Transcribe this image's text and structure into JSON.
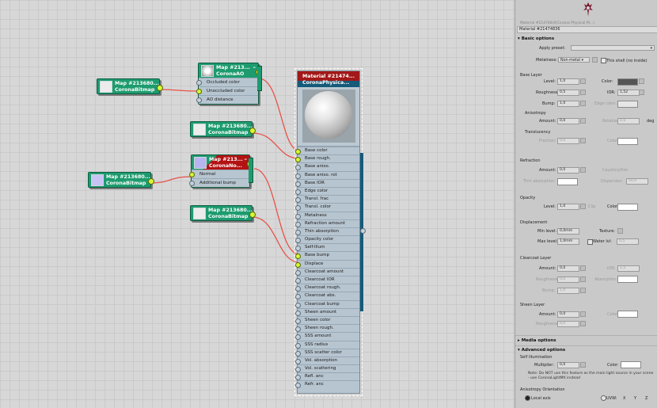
{
  "nodes": {
    "bitmap_a": {
      "title": "Map #213680...",
      "type": "CoronaBitmap"
    },
    "ao": {
      "title": "Map #213...",
      "type": "CoronaAO",
      "slots": [
        "Occluded color",
        "Unoccluded color",
        "AO distance"
      ]
    },
    "bitmap_b": {
      "title": "Map #213680...",
      "type": "CoronaBitmap"
    },
    "normal": {
      "title": "Map #213...",
      "type": "CoronaNo...",
      "slots": [
        "Normal",
        "Additional bump"
      ]
    },
    "bitmap_c": {
      "title": "Map #213680...",
      "type": "CoronaBitmap"
    },
    "bitmap_d": {
      "title": "Map #213680...",
      "type": "CoronaBitmap"
    }
  },
  "material": {
    "title": "Material #21474...",
    "type": "CoronaPhysica...",
    "slots": [
      "Base color",
      "Base rough.",
      "Base aniso.",
      "Base aniso. rot",
      "Base IOR",
      "Edge color",
      "Transl. frac",
      "Transl. color",
      "Metalness",
      "Refraction amount",
      "Thin absorption",
      "Opacity color",
      "Self-Illum",
      "Base bump",
      "Displace",
      "Clearcoat amount",
      "Clearcoat IOR",
      "Clearcoat rough.",
      "Clearcoat abs.",
      "Clearcoat bump",
      "Sheen amount",
      "Sheen color",
      "Sheen rough.",
      "SSS amount",
      "SSS radius",
      "SSS scatter color",
      "Vol. absorption",
      "Vol. scattering",
      "Refl. anc",
      "Refr. anc"
    ],
    "connected": [
      0,
      1,
      13,
      14
    ]
  },
  "panel": {
    "breadcrumb": "Material #214748/4(Corona Physical M...)",
    "material_name": "Material #21474836",
    "basic_options": "Basic options",
    "apply_preset": "Apply preset:",
    "metalness_label": "Metalness:",
    "metalness_value": "Non-metal",
    "thin_shell": "This shell (no inside)",
    "base_layer": "Base Layer",
    "level_label": "Level:",
    "level_value": "1,0",
    "color_label": "Color:",
    "roughness_label": "Roughness:",
    "roughness_value": "0,5",
    "ior_label": "IOR:",
    "ior_value": "1,52",
    "bump_label": "Bump:",
    "bump_value": "1,0",
    "edge_color_label": "Edge color:",
    "anisotropy": "Anisotropy",
    "amount_label": "Amount:",
    "amount_value": "0,0",
    "rotation_label": "Rotation:",
    "rotation_value": "0,0",
    "deg": "deg",
    "translucency": "Translucency",
    "fraction_label": "Fraction:",
    "fraction_value": "0,0",
    "refraction": "Refraction",
    "caustics_label": "Caustics/thin",
    "thin_absorption": "Thin absorption:",
    "dispersion": "Dispersion:",
    "abbe_value": "50,0",
    "opacity": "Opacity",
    "opacity_level": "1,0",
    "clip_label": "Clip",
    "displacement": "Displacement",
    "min_level_label": "Min level:",
    "min_level_value": "0,0mm",
    "max_level_label": "Max level:",
    "max_level_value": "1,0mm",
    "texture_label": "Texture:",
    "water_lvl": "Water lvl:",
    "water_value": "0,5",
    "clearcoat": "Clearcoat Layer",
    "cc_amount": "0,0",
    "cc_ior": "1,5",
    "cc_rough": "0,0",
    "cc_bump": "1,0",
    "absorption_label": "Absorption:",
    "sheen": "Sheen Layer",
    "sheen_amount": "0,0",
    "sheen_rough": "0,0",
    "media_options": "Media options",
    "advanced_options": "Advanced options",
    "self_illum": "Self illumination",
    "multiplier_label": "Multiplier:",
    "multiplier_value": "0,0",
    "note": "Note: Do NOT use this feature as the main light source in your scene - use CoronaLightMtl instead",
    "aniso_orient": "Anisotropy Orientation",
    "local_axis": "Local axis",
    "uvw_label": "UVW:",
    "axis_x": "X",
    "axis_y": "Y",
    "axis_z": "Z"
  },
  "colors": {
    "node_green": "#1d9b6f",
    "material_red": "#a31818",
    "wire": "#e8534a",
    "socket_on": "#d9f53a"
  }
}
